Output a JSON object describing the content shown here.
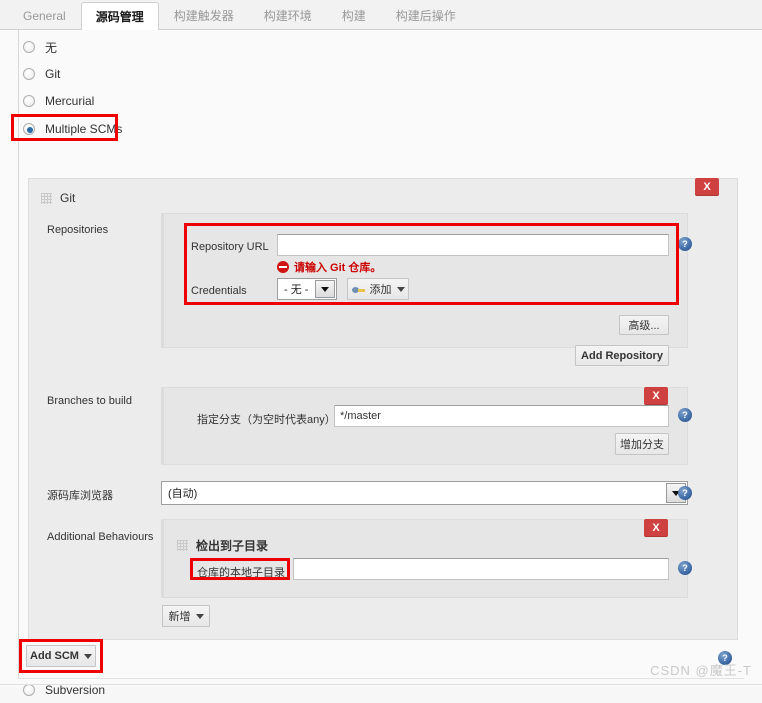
{
  "tabs": [
    {
      "label": "General",
      "active": false
    },
    {
      "label": "源码管理",
      "active": true
    },
    {
      "label": "构建触发器",
      "active": false
    },
    {
      "label": "构建环境",
      "active": false
    },
    {
      "label": "构建",
      "active": false
    },
    {
      "label": "构建后操作",
      "active": false
    }
  ],
  "scm_options": [
    {
      "label": "无",
      "checked": false
    },
    {
      "label": "Git",
      "checked": false
    },
    {
      "label": "Mercurial",
      "checked": false
    },
    {
      "label": "Multiple SCMs",
      "checked": true
    },
    {
      "label": "Subversion",
      "checked": false
    }
  ],
  "git_block": {
    "title": "Git",
    "delete_label": "X",
    "repositories": {
      "label": "Repositories",
      "repository_url_label": "Repository URL",
      "repository_url_value": "",
      "error_message": "请输入 Git 仓库。",
      "credentials_label": "Credentials",
      "credentials_value": "- 无 -",
      "add_credentials_label": "添加",
      "advanced_label": "高级...",
      "add_repository_label": "Add Repository"
    },
    "branches": {
      "label": "Branches to build",
      "delete_label": "X",
      "branch_specifier_label": "指定分支（为空时代表any）",
      "branch_specifier_value": "*/master",
      "add_branch_label": "增加分支"
    },
    "browser": {
      "label": "源码库浏览器",
      "value": "(自动)"
    },
    "additional_behaviours": {
      "label": "Additional Behaviours",
      "item_title": "检出到子目录",
      "delete_label": "X",
      "local_subdir_label": "仓库的本地子目录",
      "local_subdir_value": "",
      "add_label": "新增"
    }
  },
  "add_scm_label": "Add SCM",
  "help_symbol": "?",
  "watermark": "CSDN @魔王-T",
  "colors": {
    "annotation_red": "#ee0000",
    "delete_red": "#cf4040",
    "error_red": "#cc0000",
    "help_blue": "#3f6ca8",
    "radio_blue": "#2d6aa8"
  }
}
